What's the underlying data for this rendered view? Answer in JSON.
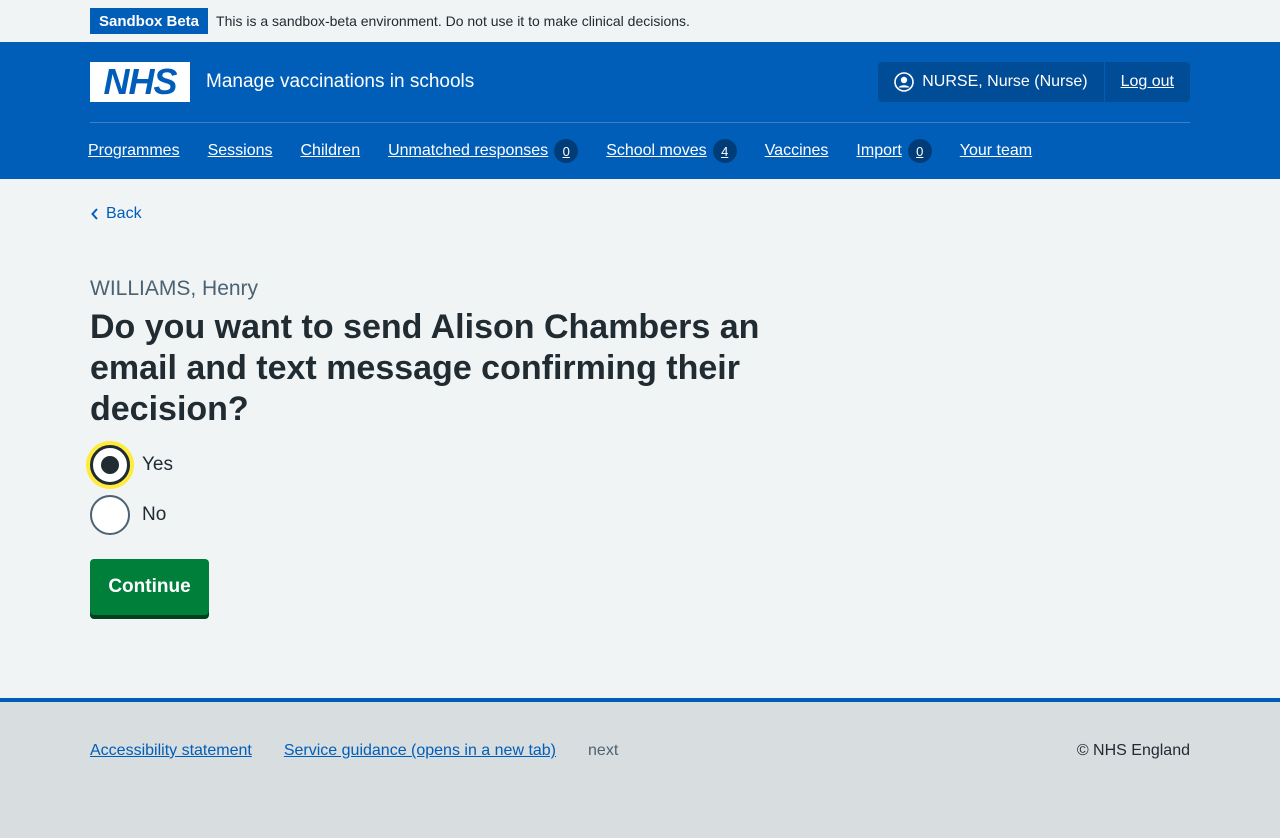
{
  "banner": {
    "tag": "Sandbox Beta",
    "text": "This is a sandbox-beta environment. Do not use it to make clinical decisions."
  },
  "header": {
    "logo": "NHS",
    "service_name": "Manage vaccinations in schools",
    "user": "NURSE, Nurse (Nurse)",
    "logout": "Log out"
  },
  "nav": [
    {
      "label": "Programmes"
    },
    {
      "label": "Sessions"
    },
    {
      "label": "Children"
    },
    {
      "label": "Unmatched responses",
      "count": "0"
    },
    {
      "label": "School moves",
      "count": "4"
    },
    {
      "label": "Vaccines"
    },
    {
      "label": "Import",
      "count": "0"
    },
    {
      "label": "Your team"
    }
  ],
  "main": {
    "back": "Back",
    "caption": "WILLIAMS, Henry",
    "heading": "Do you want to send Alison Chambers an email and text message confirming their decision?",
    "options": [
      {
        "label": "Yes",
        "checked": true
      },
      {
        "label": "No",
        "checked": false
      }
    ],
    "continue": "Continue"
  },
  "footer": {
    "links": [
      "Accessibility statement",
      "Service guidance (opens in a new tab)"
    ],
    "version": "next",
    "copyright": "© NHS England"
  },
  "colors": {
    "nhs_blue": "#005eb8",
    "button_green": "#007f3b",
    "focus_yellow": "#ffeb3b"
  }
}
